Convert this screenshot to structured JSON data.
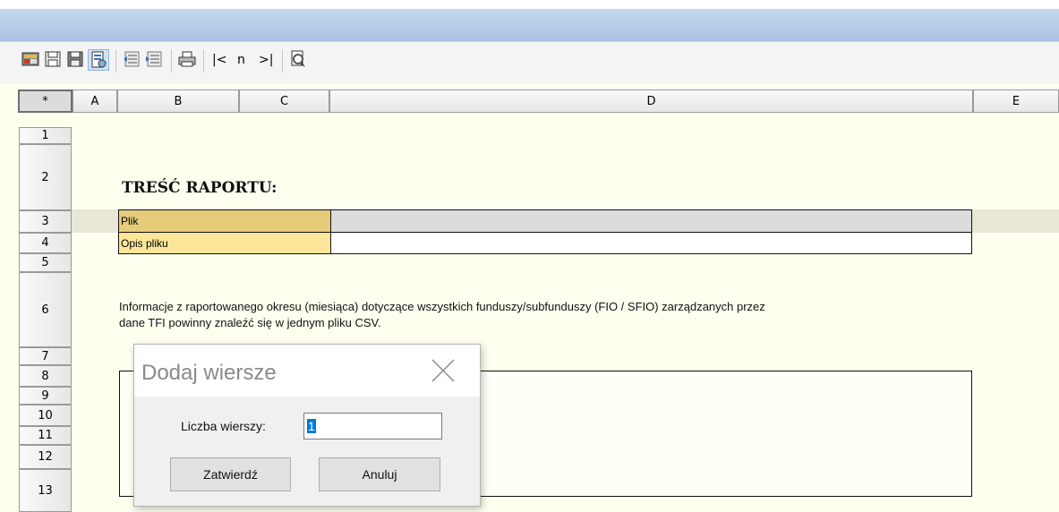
{
  "toolbar": {
    "nav_first": "|<",
    "nav_n": "n",
    "nav_last": ">|"
  },
  "columns": [
    "*",
    "A",
    "B",
    "C",
    "D",
    "E"
  ],
  "rows": [
    "1",
    "2",
    "3",
    "4",
    "5",
    "6",
    "7",
    "8",
    "9",
    "10",
    "11",
    "12",
    "13"
  ],
  "sheet": {
    "title": "TREŚĆ RAPORTU:",
    "file_label": "Plik",
    "file_value": "",
    "desc_label": "Opis pliku",
    "desc_value": "",
    "info_line1": "Informacje z raportowanego okresu (miesiąca) dotyczące wszystkich funduszy/subfunduszy (FIO / SFIO) zarządzanych przez",
    "info_line2": "dane TFI powinny znaleźć się w jednym pliku CSV."
  },
  "dialog": {
    "title": "Dodaj wiersze",
    "rows_label": "Liczba wierszy:",
    "rows_value": "1",
    "confirm_label": "Zatwierdź",
    "cancel_label": "Anuluj"
  },
  "colors": {
    "cell_label_dark": "#e6cc7a",
    "cell_label_light": "#fde69a",
    "sheet_bg": "#fffff0"
  }
}
